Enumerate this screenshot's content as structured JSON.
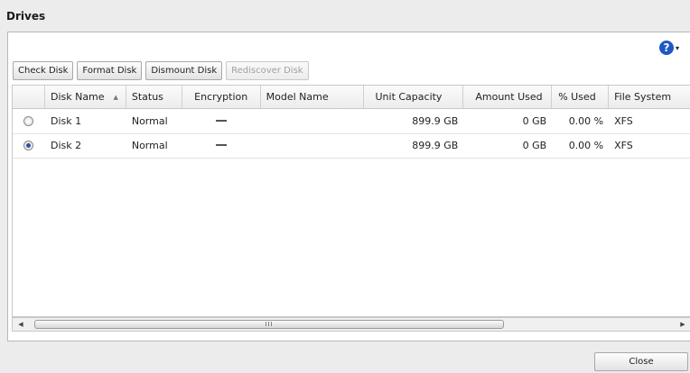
{
  "window": {
    "title": "Drives"
  },
  "help": {
    "icon": "help-icon",
    "glyph": "?",
    "menu_glyph": "▾"
  },
  "toolbar": {
    "check_disk": "Check Disk",
    "format_disk": "Format Disk",
    "dismount_disk": "Dismount Disk",
    "rediscover_disk": "Rediscover Disk"
  },
  "table": {
    "columns": {
      "disk_name": "Disk Name",
      "status": "Status",
      "encryption": "Encryption",
      "model_name": "Model Name",
      "unit_capacity": "Unit Capacity",
      "amount_used": "Amount Used",
      "percent_used": "% Used",
      "file_system": "File System"
    },
    "sort": {
      "column": "disk_name",
      "direction": "ascending",
      "icon": "sort-ascending-icon"
    },
    "rows": [
      {
        "selected": false,
        "disk_name": "Disk 1",
        "status": "Normal",
        "encryption": "—",
        "model_name": "",
        "unit_capacity": "899.9 GB",
        "amount_used": "0 GB",
        "percent_used": "0.00 %",
        "file_system": "XFS"
      },
      {
        "selected": true,
        "disk_name": "Disk 2",
        "status": "Normal",
        "encryption": "—",
        "model_name": "",
        "unit_capacity": "899.9 GB",
        "amount_used": "0 GB",
        "percent_used": "0.00 %",
        "file_system": "XFS"
      }
    ]
  },
  "scrollbar": {
    "thumb_grip": "III",
    "left_arrow": "◀",
    "right_arrow": "▶"
  },
  "footer": {
    "close": "Close"
  }
}
